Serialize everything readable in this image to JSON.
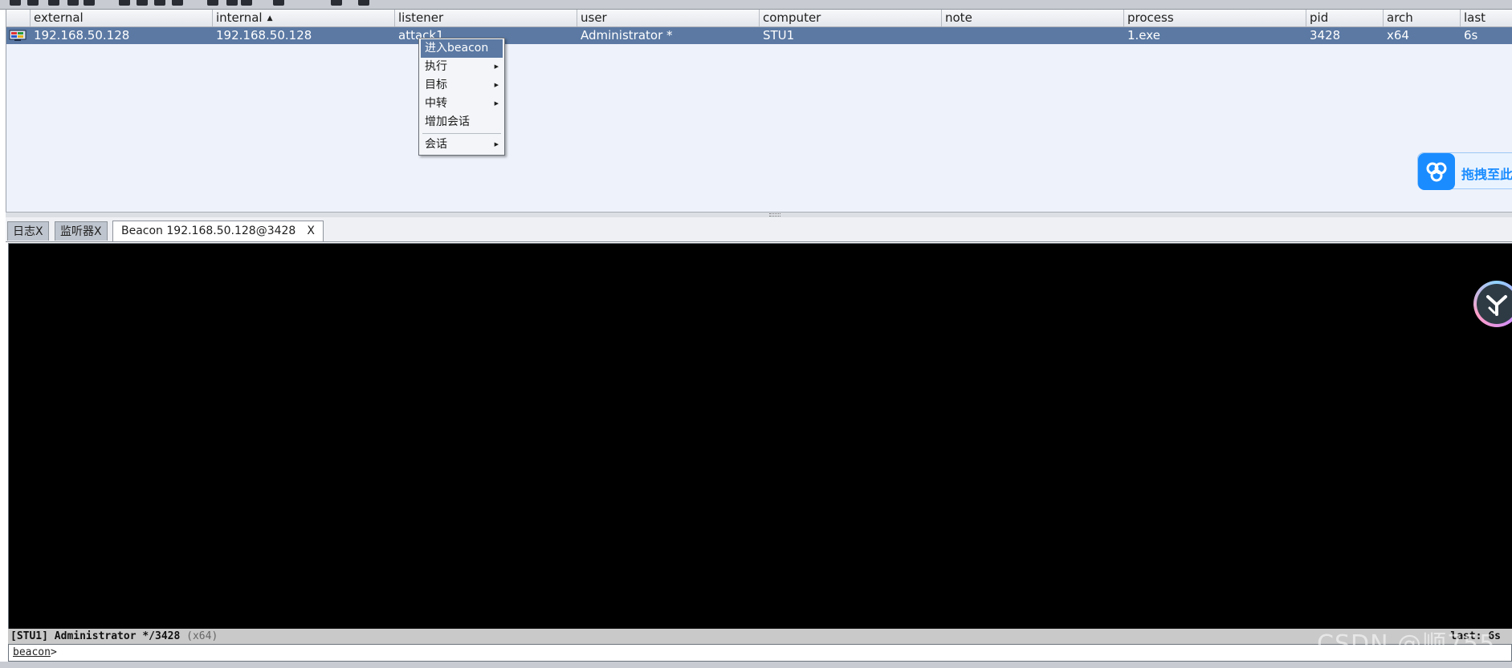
{
  "toolbar": {
    "icons": [
      "connect-icon",
      "disconnect-icon",
      "listeners-icon",
      "sessions-icon",
      "targets-icon",
      "settings-icon",
      "keystrokes-icon",
      "screenshots-icon",
      "payload-icon",
      "script-icon",
      "log-icon",
      "link-icon",
      "help-icon"
    ]
  },
  "table": {
    "columns": [
      "external",
      "internal",
      "listener",
      "user",
      "computer",
      "note",
      "process",
      "pid",
      "arch",
      "last"
    ],
    "sort_column": "internal",
    "rows": [
      {
        "external": "192.168.50.128",
        "internal": "192.168.50.128",
        "listener": "attack1",
        "user": "Administrator *",
        "computer": "STU1",
        "note": "",
        "process": "1.exe",
        "pid": "3428",
        "arch": "x64",
        "last": "6s"
      }
    ]
  },
  "context_menu": {
    "items": [
      {
        "label": "进入beacon",
        "submenu": false,
        "selected": true
      },
      {
        "label": "执行",
        "submenu": true
      },
      {
        "label": "目标",
        "submenu": true
      },
      {
        "label": "中转",
        "submenu": true
      },
      {
        "label": "增加会话",
        "submenu": false
      },
      {
        "label": "会话",
        "submenu": true
      }
    ]
  },
  "tabs": [
    {
      "label": "日志",
      "close": "X"
    },
    {
      "label": "监听器",
      "close": "X"
    },
    {
      "label": "Beacon 192.168.50.128@3428",
      "close": "X",
      "active": true
    }
  ],
  "console": {
    "status": "[STU1] Administrator */3428",
    "status_arch": "(x64)",
    "status_right": "last: 6s",
    "prompt": "beacon",
    "prompt_suffix": ">"
  },
  "overlays": {
    "baidu_label": "拖拽至此",
    "watermark": "CSDN @顺755"
  },
  "colors": {
    "selection": "#5b79a3",
    "console_bg": "#000000",
    "table_bg": "#eef2fb",
    "baidu_blue": "#1a8cff"
  }
}
